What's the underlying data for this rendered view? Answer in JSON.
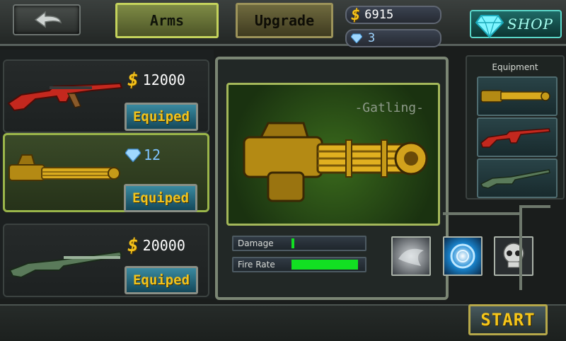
{
  "header": {
    "back_icon": "back-arrow-icon",
    "tabs": [
      {
        "label": "Arms",
        "active": true
      },
      {
        "label": "Upgrade",
        "active": false
      }
    ],
    "gold_amount": "6915",
    "gem_amount": "3",
    "shop_label": "SHOP"
  },
  "weapon_list": [
    {
      "name": "ak-rifle-red",
      "currency": "gold",
      "price": "12000",
      "button": "Equiped",
      "selected": false
    },
    {
      "name": "gatling-gold",
      "currency": "gem",
      "price": "12",
      "button": "Equiped",
      "selected": true
    },
    {
      "name": "shotgun-green",
      "currency": "gold",
      "price": "20000",
      "button": "Equiped",
      "selected": false
    }
  ],
  "detail": {
    "weapon_name": "-Gatling-",
    "stats": [
      {
        "label": "Damage",
        "value": 0.03
      },
      {
        "label": "Fire Rate",
        "value": 0.93
      }
    ],
    "skills": [
      "storm-skill-icon",
      "vortex-skill-icon",
      "skull-skill-icon"
    ]
  },
  "equipment": {
    "title": "Equipment",
    "slots": [
      "gatling-gold",
      "ak-rifle-red",
      "shotgun-green"
    ]
  },
  "start_label": "START",
  "colors": {
    "gold": "#f4c21a",
    "gem": "#7fc4ff",
    "stat_fill": "#12e022",
    "selected_border": "#9ab54a"
  }
}
